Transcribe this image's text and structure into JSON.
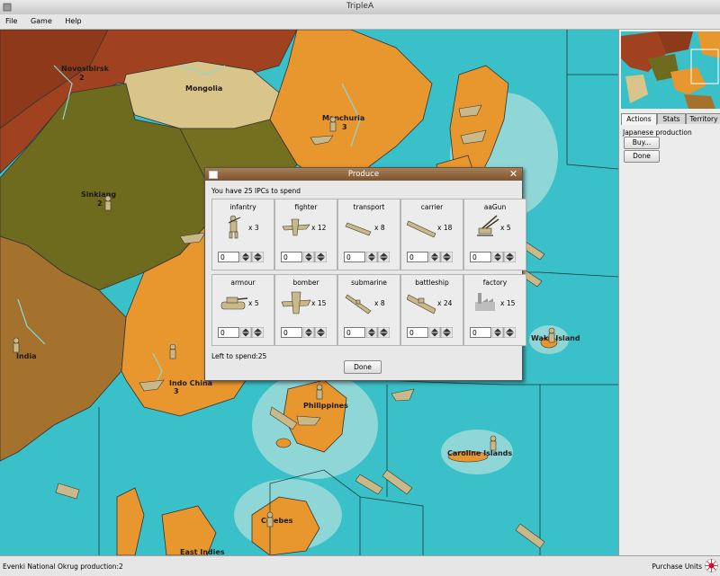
{
  "window": {
    "title": "TripleA"
  },
  "menu": [
    "File",
    "Game",
    "Help"
  ],
  "map_labels": {
    "novosibirsk": "Novosibirsk",
    "novosibirsk_val": "2",
    "mongolia": "Mongolia",
    "manchuria": "Manchuria",
    "manchuria_val": "3",
    "sinkiang": "Sinkiang",
    "sinkiang_val": "2",
    "india": "India",
    "indochina": "Indo China",
    "indochina_val": "3",
    "philippines": "Philippines",
    "wake": "Wake Island",
    "caroline": "Caroline Islands",
    "celebes": "Celebes",
    "east_indies": "East Indies"
  },
  "side": {
    "tabs": [
      "Actions",
      "Stats",
      "Territory"
    ],
    "production_label": "Japanese production",
    "buy_button": "Buy...",
    "done_button": "Done"
  },
  "status": {
    "left": "Evenki National Okrug production:2",
    "right": "Purchase Units"
  },
  "dialog": {
    "title": "Produce",
    "ipc_text": "You have 25 IPCs  to spend",
    "units": [
      {
        "name": "infantry",
        "cost": "x 3",
        "qty": "0"
      },
      {
        "name": "fighter",
        "cost": "x 12",
        "qty": "0"
      },
      {
        "name": "transport",
        "cost": "x 8",
        "qty": "0"
      },
      {
        "name": "carrier",
        "cost": "x 18",
        "qty": "0"
      },
      {
        "name": "aaGun",
        "cost": "x 5",
        "qty": "0"
      },
      {
        "name": "armour",
        "cost": "x 5",
        "qty": "0"
      },
      {
        "name": "bomber",
        "cost": "x 15",
        "qty": "0"
      },
      {
        "name": "submarine",
        "cost": "x 8",
        "qty": "0"
      },
      {
        "name": "battleship",
        "cost": "x 24",
        "qty": "0"
      },
      {
        "name": "factory",
        "cost": "x 15",
        "qty": "0"
      }
    ],
    "left_to_spend": "Left to spend:25",
    "done_label": "Done"
  },
  "colors": {
    "sea": "#39c0c8",
    "japan": "#e8962e",
    "russia": "#a0421f",
    "china": "#6e6a1e",
    "mongolia": "#d9c489",
    "neutral": "#a5722e",
    "dialog_title": "#8f6640"
  }
}
